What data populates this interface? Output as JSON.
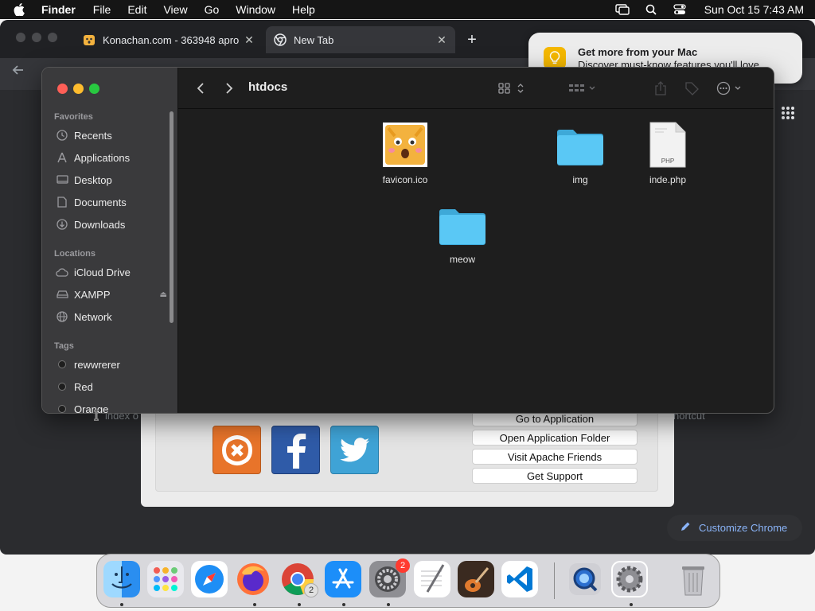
{
  "menubar": {
    "app_name": "Finder",
    "menus": [
      "File",
      "Edit",
      "View",
      "Go",
      "Window",
      "Help"
    ],
    "clock": "Sun Oct 15  7:43 AM",
    "icons": [
      "apple-icon",
      "screen-mirror-icon",
      "spotlight-icon",
      "control-center-icon"
    ]
  },
  "browser": {
    "tabs": [
      {
        "title": "Konachan.com - 363948 apro",
        "active": false
      },
      {
        "title": "New Tab",
        "active": true
      }
    ],
    "bg_text_left": "index o",
    "bg_text_right": "hortcut",
    "customize_label": "Customize Chrome"
  },
  "notification": {
    "title": "Get more from your Mac",
    "body": "Discover must-know features you'll love."
  },
  "finder": {
    "folder_title": "htdocs",
    "sidebar": {
      "favorites_header": "Favorites",
      "favorites": [
        {
          "label": "Recents",
          "icon": "clock-icon"
        },
        {
          "label": "Applications",
          "icon": "applications-icon"
        },
        {
          "label": "Desktop",
          "icon": "desktop-icon"
        },
        {
          "label": "Documents",
          "icon": "document-icon"
        },
        {
          "label": "Downloads",
          "icon": "downloads-icon"
        }
      ],
      "locations_header": "Locations",
      "locations": [
        {
          "label": "iCloud Drive",
          "icon": "cloud-icon"
        },
        {
          "label": "XAMPP",
          "icon": "disk-icon"
        },
        {
          "label": "Network",
          "icon": "network-icon"
        }
      ],
      "tags_header": "Tags",
      "tags": [
        {
          "label": "rewwrerer"
        },
        {
          "label": "Red"
        },
        {
          "label": "Orange"
        }
      ]
    },
    "files": [
      {
        "name": "favicon.ico",
        "type": "image"
      },
      {
        "name": "img",
        "type": "folder"
      },
      {
        "name": "inde.php",
        "type": "php"
      },
      {
        "name": "meow",
        "type": "folder"
      }
    ],
    "php_label": "PHP"
  },
  "xampp": {
    "buttons": [
      "Go to Application",
      "Open Application Folder",
      "Visit Apache Friends",
      "Get Support"
    ],
    "logos": [
      "xampp-logo",
      "facebook-logo",
      "twitter-logo"
    ]
  },
  "dock": {
    "apps": [
      "finder",
      "launchpad",
      "safari",
      "firefox",
      "chrome",
      "app-store",
      "system-settings",
      "textedit",
      "garageband",
      "vscode",
      "quicktime",
      "settings-gear",
      "trash"
    ],
    "system_settings_badge": "2",
    "chrome_badge": "2"
  },
  "colors": {
    "folder_blue": "#5ac8f5",
    "close": "#ff5f57",
    "minimize": "#febc2e",
    "zoom": "#28c840",
    "accent_link": "#8ab4f8"
  }
}
